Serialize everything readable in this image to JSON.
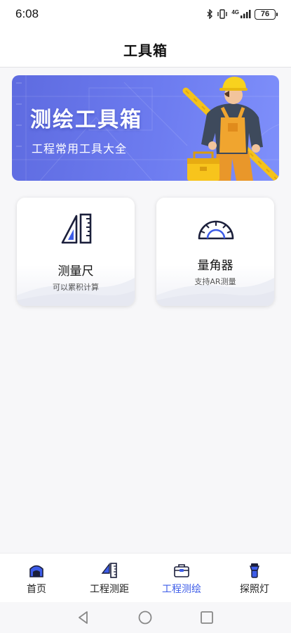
{
  "status_bar": {
    "time": "6:08",
    "network": "4G",
    "battery": "76"
  },
  "header": {
    "title": "工具箱"
  },
  "banner": {
    "title": "测绘工具箱",
    "subtitle": "工程常用工具大全"
  },
  "tools": [
    {
      "title": "测量尺",
      "desc": "可以累积计算",
      "icon": "ruler-triangle-icon"
    },
    {
      "title": "量角器",
      "desc": "支持AR测量",
      "icon": "protractor-icon"
    }
  ],
  "tab_bar": {
    "active_index": 2,
    "active_color": "#3d5ce8",
    "items": [
      {
        "label": "首页",
        "icon": "home-icon"
      },
      {
        "label": "工程测距",
        "icon": "ruler-icon"
      },
      {
        "label": "工程测绘",
        "icon": "toolbox-icon"
      },
      {
        "label": "探照灯",
        "icon": "flashlight-icon"
      }
    ]
  },
  "colors": {
    "accent": "#3d5ce8",
    "banner_start": "#5e6be0",
    "banner_end": "#7f90fb"
  }
}
